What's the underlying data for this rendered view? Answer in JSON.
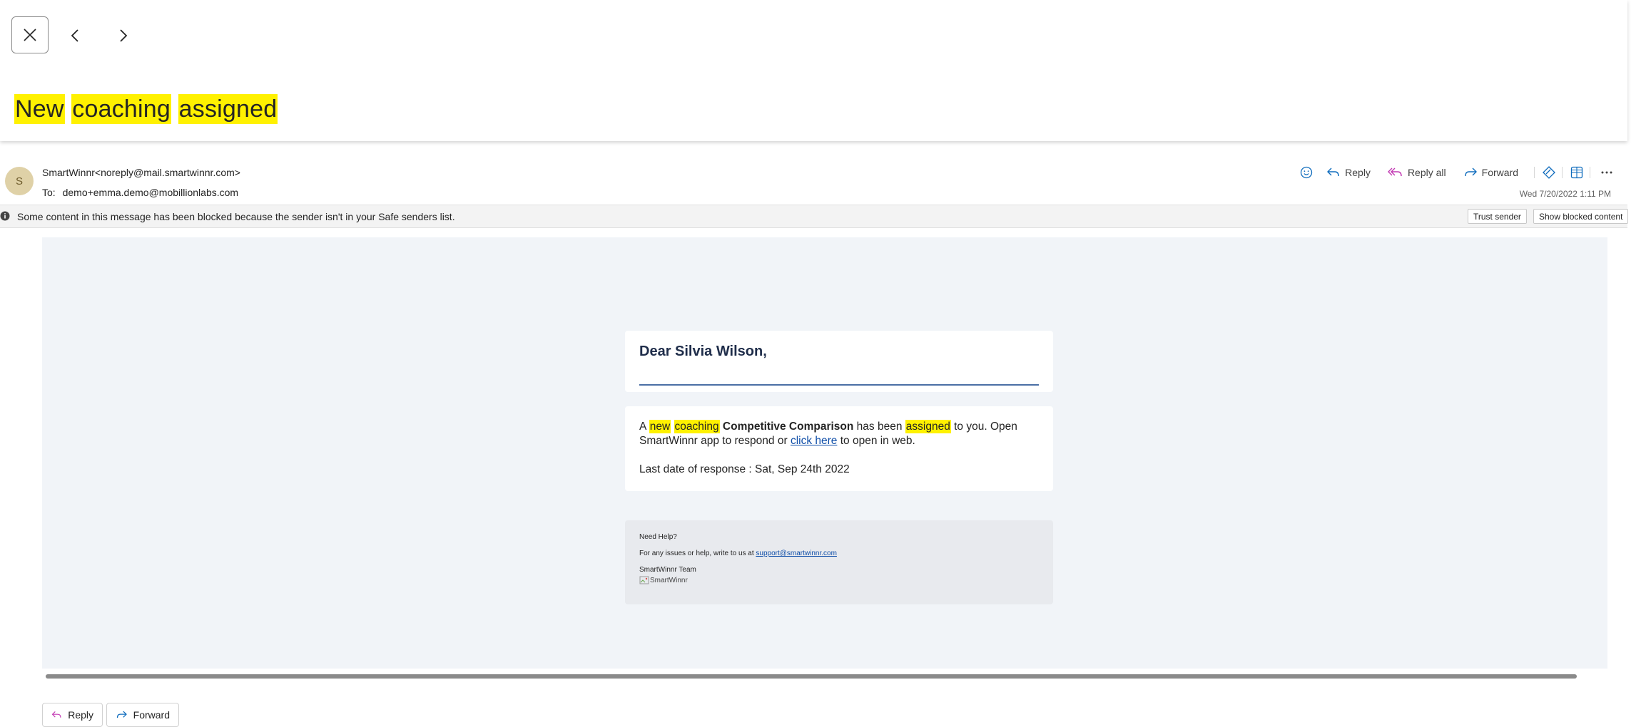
{
  "reader": {
    "close_icon": "close-icon",
    "prev_icon": "chevron-left-icon",
    "next_icon": "chevron-right-icon"
  },
  "subject": {
    "words": [
      "New",
      "coaching",
      "assigned"
    ],
    "highlight_color": "#fff100"
  },
  "message": {
    "avatar_letter": "S",
    "from": "SmartWinnr<noreply@mail.smartwinnr.com>",
    "to_label": "To:",
    "to": "demo+emma.demo@mobillionlabs.com",
    "date": "Wed 7/20/2022 1:11 PM",
    "actions": {
      "emoji_icon": "smiley-icon",
      "reply": "Reply",
      "reply_all": "Reply all",
      "forward": "Forward",
      "sensitivity_icon": "tag-icon",
      "apps_icon": "apps-grid-icon",
      "more_icon": "more-icon"
    }
  },
  "blocked": {
    "text": "Some content in this message has been blocked because the sender isn't in your Safe senders list.",
    "trust_sender": "Trust sender",
    "show_blocked": "Show blocked content"
  },
  "email": {
    "greeting": "Dear Silvia Wilson,",
    "msg": {
      "a": "A",
      "new": "new",
      "coaching": "coaching",
      "title": "Competitive Comparison",
      "has_been": "has been",
      "assigned": "assigned",
      "to_you": "to you. Open SmartWinnr app to respond or",
      "click_here": "click here",
      "to_open": "to open in web."
    },
    "last_date": "Last date of response : Sat, Sep 24th 2022",
    "footer": {
      "need_help": "Need Help?",
      "issues": "For any issues or help, write to us at",
      "support_email": "support@smartwinnr.com",
      "team": "SmartWinnr Team",
      "logo_alt": "SmartWinnr"
    }
  },
  "bottom": {
    "reply": "Reply",
    "forward": "Forward"
  },
  "colors": {
    "accent": "#0f6cbd",
    "body_bg": "#f1f4f8",
    "link": "#0f4ea8"
  }
}
